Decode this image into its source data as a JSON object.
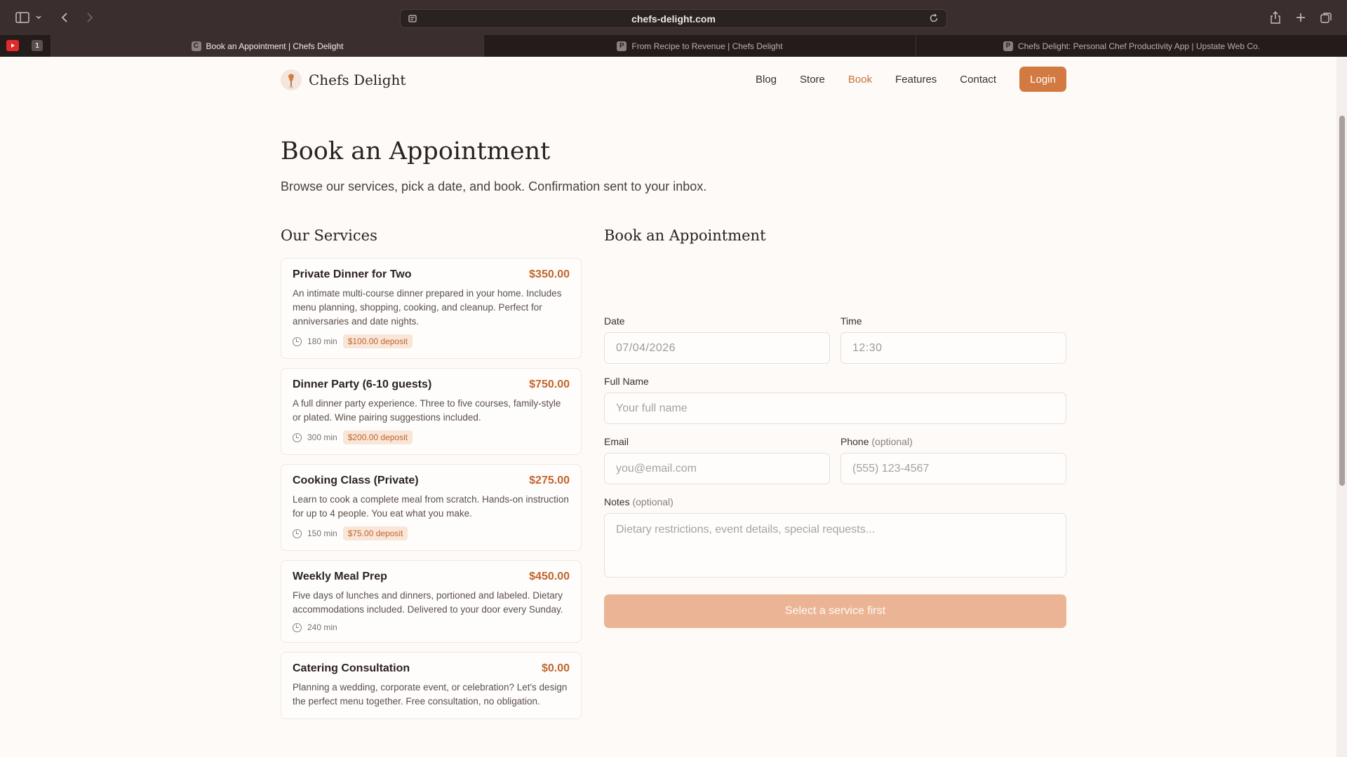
{
  "browser": {
    "url": "chefs-delight.com",
    "tabs": [
      {
        "label": "Book an Appointment | Chefs Delight",
        "favicon": "C",
        "active": true
      },
      {
        "label": "From Recipe to Revenue | Chefs Delight",
        "favicon": "P",
        "active": false
      },
      {
        "label": "Chefs Delight: Personal Chef Productivity App | Upstate Web Co.",
        "favicon": "P",
        "active": false
      }
    ],
    "pinned_tab_count": "1"
  },
  "nav": {
    "brand": "Chefs Delight",
    "links": [
      {
        "label": "Blog",
        "active": false
      },
      {
        "label": "Store",
        "active": false
      },
      {
        "label": "Book",
        "active": true
      },
      {
        "label": "Features",
        "active": false
      },
      {
        "label": "Contact",
        "active": false
      }
    ],
    "login_label": "Login"
  },
  "page": {
    "title": "Book an Appointment",
    "subtitle": "Browse our services, pick a date, and book. Confirmation sent to your inbox."
  },
  "services": {
    "heading": "Our Services",
    "items": [
      {
        "title": "Private Dinner for Two",
        "price": "$350.00",
        "description": "An intimate multi-course dinner prepared in your home. Includes menu planning, shopping, cooking, and cleanup. Perfect for anniversaries and date nights.",
        "duration": "180 min",
        "deposit": "$100.00 deposit"
      },
      {
        "title": "Dinner Party (6-10 guests)",
        "price": "$750.00",
        "description": "A full dinner party experience. Three to five courses, family-style or plated. Wine pairing suggestions included.",
        "duration": "300 min",
        "deposit": "$200.00 deposit"
      },
      {
        "title": "Cooking Class (Private)",
        "price": "$275.00",
        "description": "Learn to cook a complete meal from scratch. Hands-on instruction for up to 4 people. You eat what you make.",
        "duration": "150 min",
        "deposit": "$75.00 deposit"
      },
      {
        "title": "Weekly Meal Prep",
        "price": "$450.00",
        "description": "Five days of lunches and dinners, portioned and labeled. Dietary accommodations included. Delivered to your door every Sunday.",
        "duration": "240 min",
        "deposit": ""
      },
      {
        "title": "Catering Consultation",
        "price": "$0.00",
        "description": "Planning a wedding, corporate event, or celebration? Let's design the perfect menu together. Free consultation, no obligation.",
        "duration": "",
        "deposit": ""
      }
    ]
  },
  "form": {
    "heading": "Book an Appointment",
    "date_label": "Date",
    "date_value": "07/04/2026",
    "time_label": "Time",
    "time_value": "12:30",
    "name_label": "Full Name",
    "name_placeholder": "Your full name",
    "email_label": "Email",
    "email_placeholder": "you@email.com",
    "phone_label": "Phone",
    "phone_optional": "(optional)",
    "phone_placeholder": "(555) 123-4567",
    "notes_label": "Notes",
    "notes_optional": "(optional)",
    "notes_placeholder": "Dietary restrictions, event details, special requests...",
    "submit_label": "Select a service first"
  },
  "colors": {
    "accent": "#d27a41",
    "price": "#c2652d",
    "background": "#fdfaf7",
    "submit_disabled": "#ebb595"
  }
}
